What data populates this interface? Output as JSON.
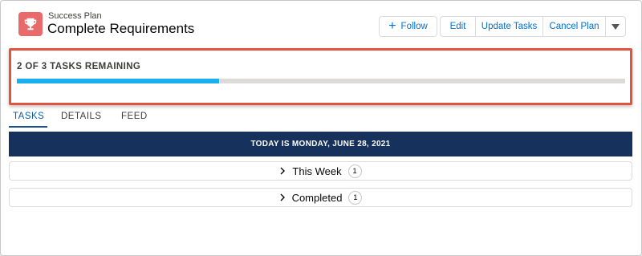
{
  "header": {
    "record_type": "Success Plan",
    "title": "Complete Requirements",
    "icon": "trophy-icon",
    "icon_color": "#e86a6a"
  },
  "actions": {
    "follow": "Follow",
    "edit": "Edit",
    "update_tasks": "Update Tasks",
    "cancel_plan": "Cancel Plan",
    "more_icon": "chevron-down-icon"
  },
  "progress": {
    "label": "2 OF 3 TASKS REMAINING",
    "completed": 1,
    "total": 3,
    "fraction": 0.333,
    "fill_color": "#1ab0f0",
    "highlight_color": "#e0553f"
  },
  "tabs": [
    {
      "label": "TASKS",
      "active": true
    },
    {
      "label": "DETAILS",
      "active": false
    },
    {
      "label": "FEED",
      "active": false
    }
  ],
  "banner": {
    "text": "TODAY IS MONDAY, JUNE 28, 2021",
    "color": "#16325c"
  },
  "sections": [
    {
      "label": "This Week",
      "count": "1"
    },
    {
      "label": "Completed",
      "count": "1"
    }
  ]
}
